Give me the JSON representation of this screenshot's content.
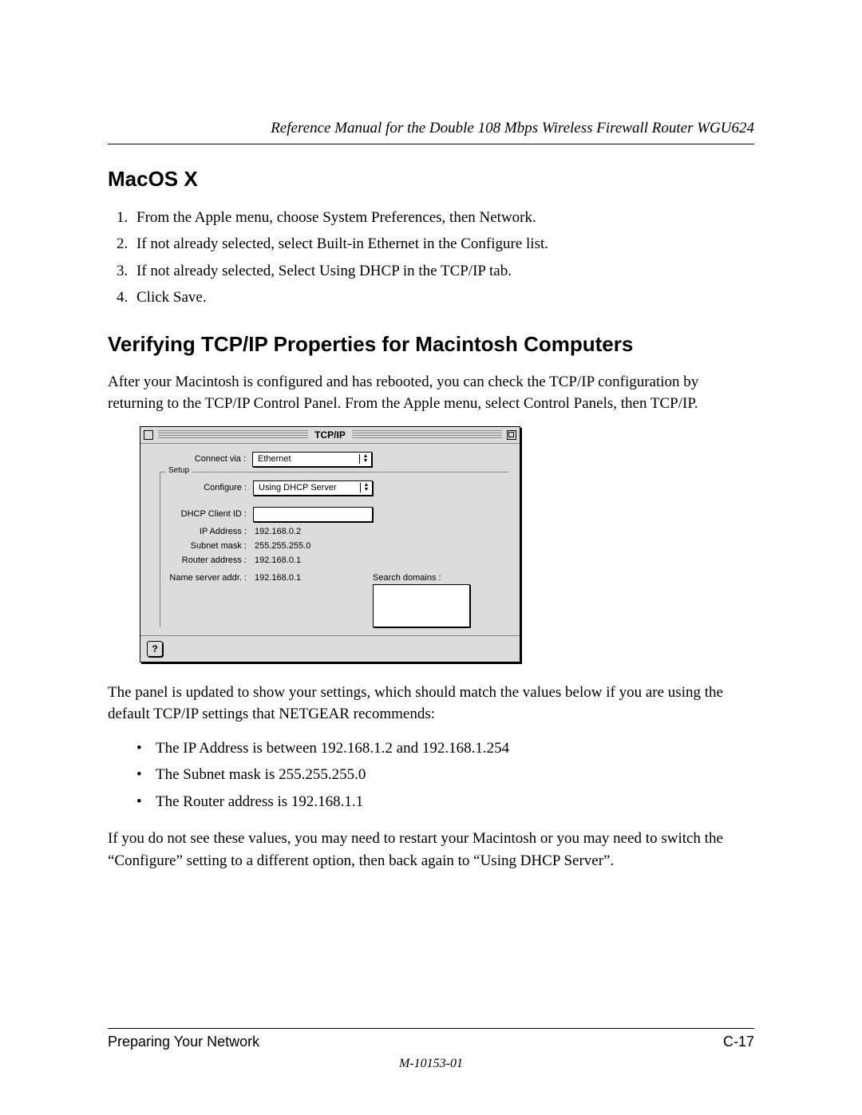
{
  "header": {
    "running_title": "Reference Manual for the Double 108 Mbps Wireless Firewall Router WGU624"
  },
  "section1": {
    "title": "MacOS X",
    "steps": [
      "From the Apple menu, choose System Preferences, then Network.",
      "If not already selected, select Built-in Ethernet in the Configure list.",
      "If not already selected, Select Using DHCP in the TCP/IP tab.",
      "Click Save."
    ]
  },
  "section2": {
    "title": "Verifying TCP/IP Properties for Macintosh Computers",
    "intro": "After your Macintosh is configured and has rebooted, you can check the TCP/IP configuration by returning to the TCP/IP Control Panel. From the Apple menu, select Control Panels, then TCP/IP.",
    "panel": {
      "title": "TCP/IP",
      "connect_via_label": "Connect via :",
      "connect_via_value": "Ethernet",
      "setup_legend": "Setup",
      "configure_label": "Configure :",
      "configure_value": "Using DHCP Server",
      "dhcp_client_label": "DHCP Client ID :",
      "dhcp_client_value": "",
      "ip_label": "IP Address :",
      "ip_value": "192.168.0.2",
      "subnet_label": "Subnet mask :",
      "subnet_value": "255.255.255.0",
      "router_label": "Router address :",
      "router_value": "192.168.0.1",
      "ns_label": "Name server addr. :",
      "ns_value": "192.168.0.1",
      "search_domains_label": "Search domains :",
      "help_glyph": "?"
    },
    "post_panel": "The panel is updated to show your settings, which should match the values below if you are using the default TCP/IP settings that NETGEAR recommends:",
    "bullets": [
      "The IP Address is between 192.168.1.2 and 192.168.1.254",
      "The Subnet mask is 255.255.255.0",
      "The Router address is 192.168.1.1"
    ],
    "closing": "If you do not see these values, you may need to restart your Macintosh or you may need to switch the “Configure” setting to a different option, then back again to “Using DHCP Server”."
  },
  "footer": {
    "left": "Preparing Your Network",
    "right": "C-17",
    "docnum": "M-10153-01"
  }
}
